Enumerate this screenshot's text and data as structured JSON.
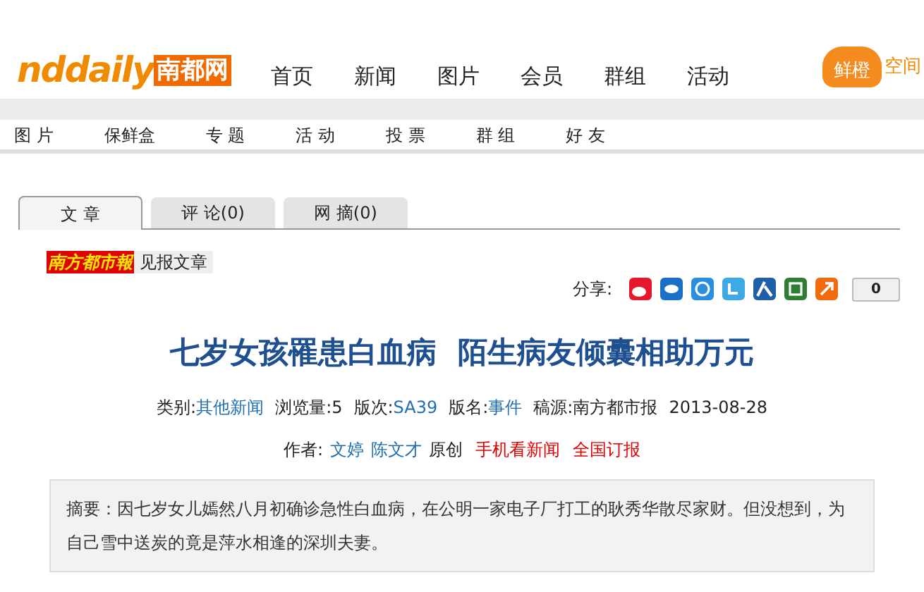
{
  "logo": {
    "latin": "nddaily",
    "chinese": "南都网"
  },
  "nav": [
    "首页",
    "新闻",
    "图片",
    "会员",
    "群组",
    "活动"
  ],
  "promo": {
    "badge": "鲜橙",
    "text": "空间"
  },
  "subnav": [
    "图 片",
    "保鲜盒",
    "专 题",
    "活 动",
    "投 票",
    "群 组",
    "好 友"
  ],
  "tabs": [
    {
      "label": "文 章",
      "selected": true
    },
    {
      "label": "评 论(0)",
      "selected": false
    },
    {
      "label": "网 摘(0)",
      "selected": false
    }
  ],
  "paper": {
    "name": "南方都市報",
    "link": "见报文章"
  },
  "share": {
    "label": "分享:",
    "count": "0"
  },
  "title": "七岁女孩罹患白血病  陌生病友倾囊相助万元",
  "meta": [
    {
      "label": "类别:",
      "value": "其他新闻",
      "link": true
    },
    {
      "label": "浏览量:",
      "value": "5",
      "link": false
    },
    {
      "label": "版次:",
      "value": "SA39",
      "link": true
    },
    {
      "label": "版名:",
      "value": "事件",
      "link": true
    },
    {
      "label": "稿源:",
      "value": "南方都市报",
      "link": false
    },
    {
      "value": "2013-08-28",
      "link": false
    }
  ],
  "byline": {
    "label": "作者:",
    "authors": [
      "文婷",
      "陈文才"
    ],
    "note": "原创",
    "links": [
      "手机看新闻",
      "全国订报"
    ]
  },
  "summary": "摘要：因七岁女儿嫣然八月初确诊急性白血病，在公明一家电子厂打工的耿秀华散尽家财。但没想到，为自己雪中送炭的竟是萍水相逢的深圳夫妻。"
}
